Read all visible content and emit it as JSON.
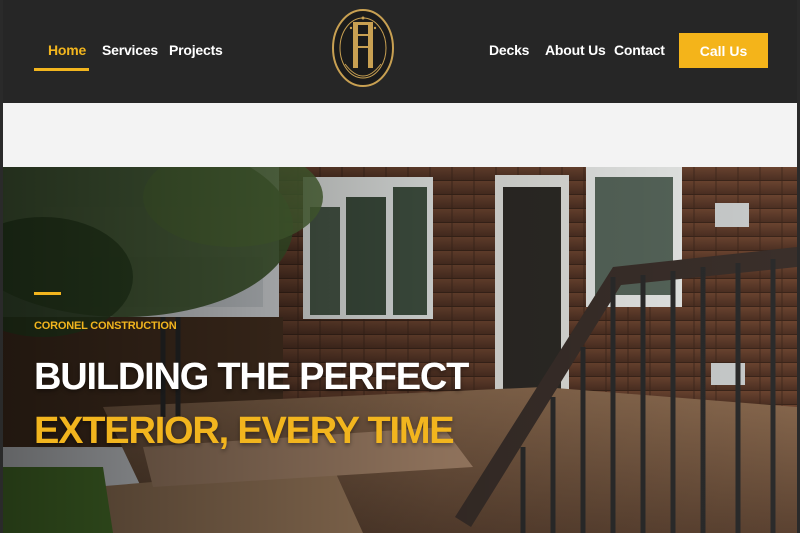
{
  "nav": {
    "left": [
      {
        "label": "Home",
        "active": true
      },
      {
        "label": "Services",
        "active": false
      },
      {
        "label": "Projects",
        "active": false
      }
    ],
    "right": [
      {
        "label": "Decks"
      },
      {
        "label": "About Us"
      },
      {
        "label": "Contact"
      }
    ],
    "cta_label": "Call Us"
  },
  "logo": {
    "text": "CORONEL CONSTRUCTION CA"
  },
  "hero": {
    "eyebrow": "CORONEL CONSTRUCTION",
    "headline_line1": "BUILDING THE PERFECT",
    "headline_line2": "EXTERIOR, EVERY TIME"
  },
  "colors": {
    "accent": "#f2b51e",
    "header_bg": "#262626",
    "strip_bg": "#f3f3f3"
  }
}
